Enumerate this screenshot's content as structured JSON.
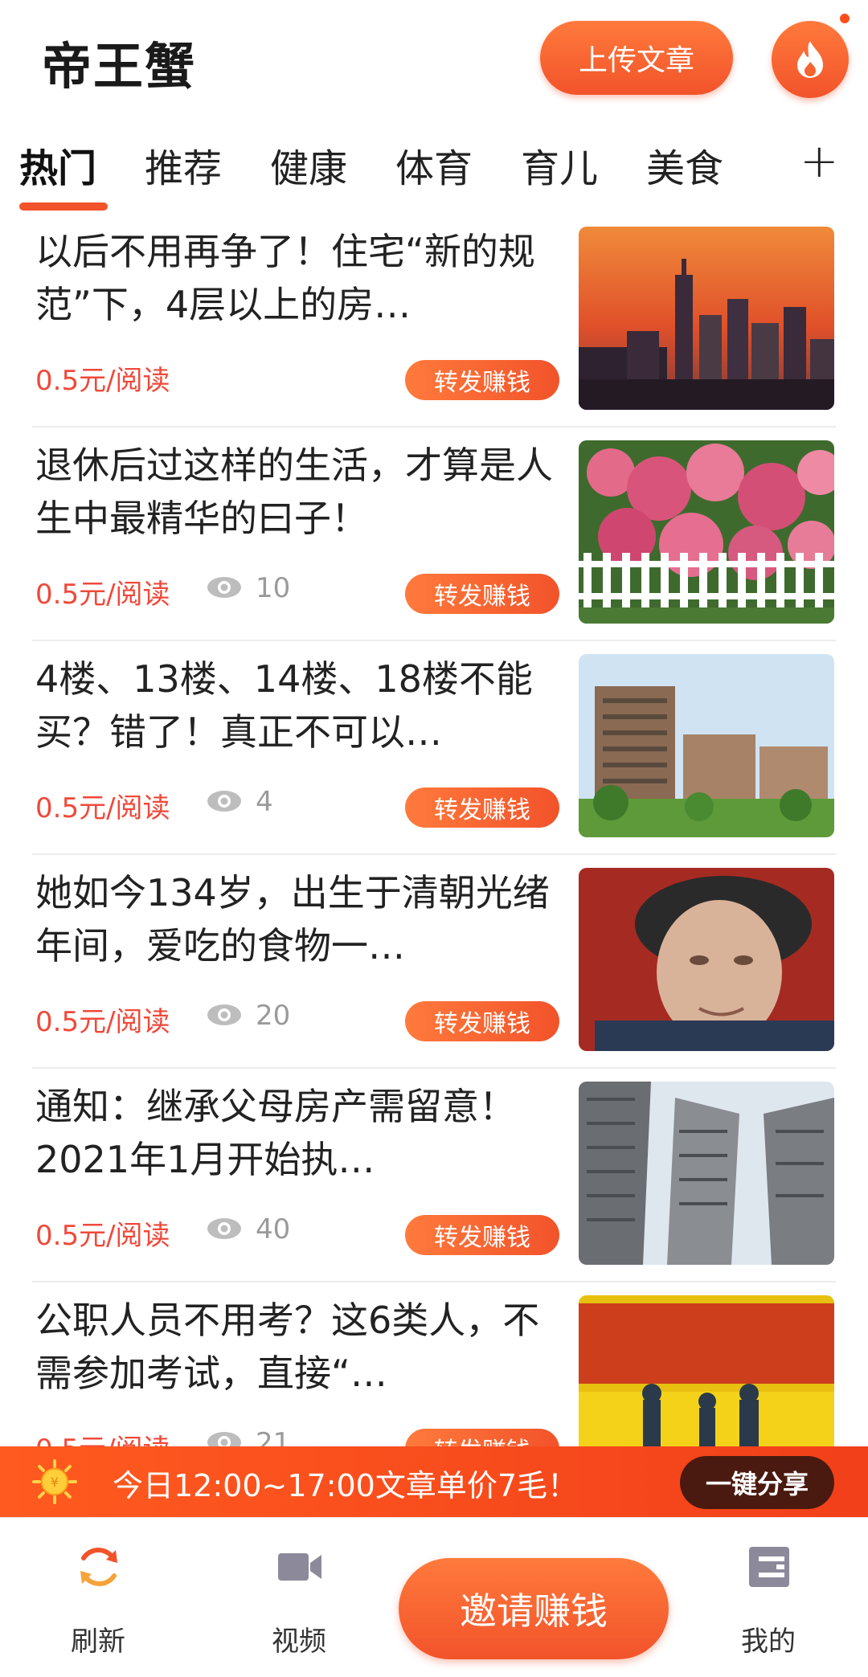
{
  "header": {
    "title": "帝王蟹",
    "upload_label": "上传文章"
  },
  "tabs": [
    {
      "label": "热门",
      "active": true
    },
    {
      "label": "推荐"
    },
    {
      "label": "健康"
    },
    {
      "label": "体育"
    },
    {
      "label": "育儿"
    },
    {
      "label": "美食"
    }
  ],
  "tab_add": "+",
  "articles": [
    {
      "title": "以后不用再争了！住宅“新的规范”下，4层以上的房…",
      "price": "0.5元/阅读",
      "views": "",
      "share_label": "转发赚钱"
    },
    {
      "title": "退休后过这样的生活，才算是人生中最精华的曰子！",
      "price": "0.5元/阅读",
      "views": "10",
      "share_label": "转发赚钱"
    },
    {
      "title": "4楼、13楼、14楼、18楼不能买？错了！真正不可以…",
      "price": "0.5元/阅读",
      "views": "4",
      "share_label": "转发赚钱"
    },
    {
      "title": "她如今134岁，出生于清朝光绪年间，爱吃的食物一…",
      "price": "0.5元/阅读",
      "views": "20",
      "share_label": "转发赚钱"
    },
    {
      "title": "通知：继承父母房产需留意！2021年1月开始执…",
      "price": "0.5元/阅读",
      "views": "40",
      "share_label": "转发赚钱"
    },
    {
      "title": "公职人员不用考？这6类人，不需参加考试，直接“…",
      "price": "0.5元/阅读",
      "views": "21",
      "share_label": "转发赚钱"
    }
  ],
  "promo": {
    "text": "今日12:00~17:00文章单价7毛！",
    "button": "一键分享"
  },
  "nav": {
    "refresh": "刷新",
    "video": "视频",
    "invite": "邀请赚钱",
    "mine": "我的"
  },
  "colors": {
    "accent": "#f2532a",
    "price": "#f0493a"
  }
}
